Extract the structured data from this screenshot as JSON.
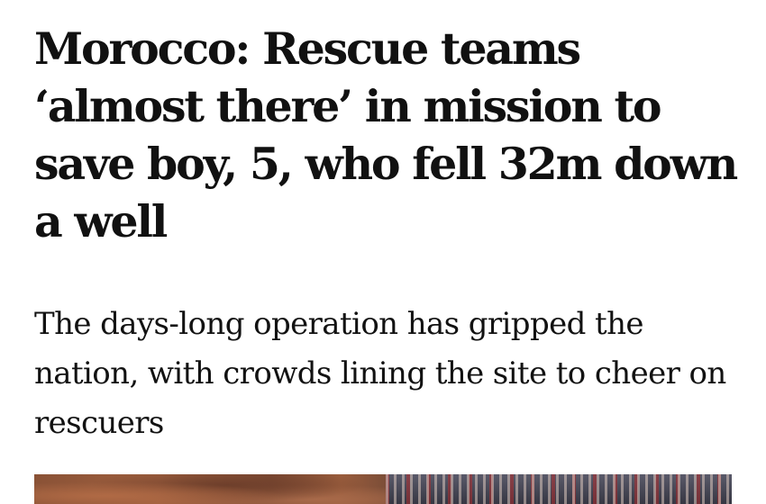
{
  "article": {
    "headline": "Morocco: Rescue teams ‘almost there’ in mission to save boy, 5, who fell 32m down a well",
    "standfirst": "The days-long operation has gripped the nation, with crowds lining the site to cheer on rescuers"
  },
  "colors": {
    "background": "#ffffff",
    "headline_text": "#111111",
    "standfirst_text": "#121212"
  }
}
